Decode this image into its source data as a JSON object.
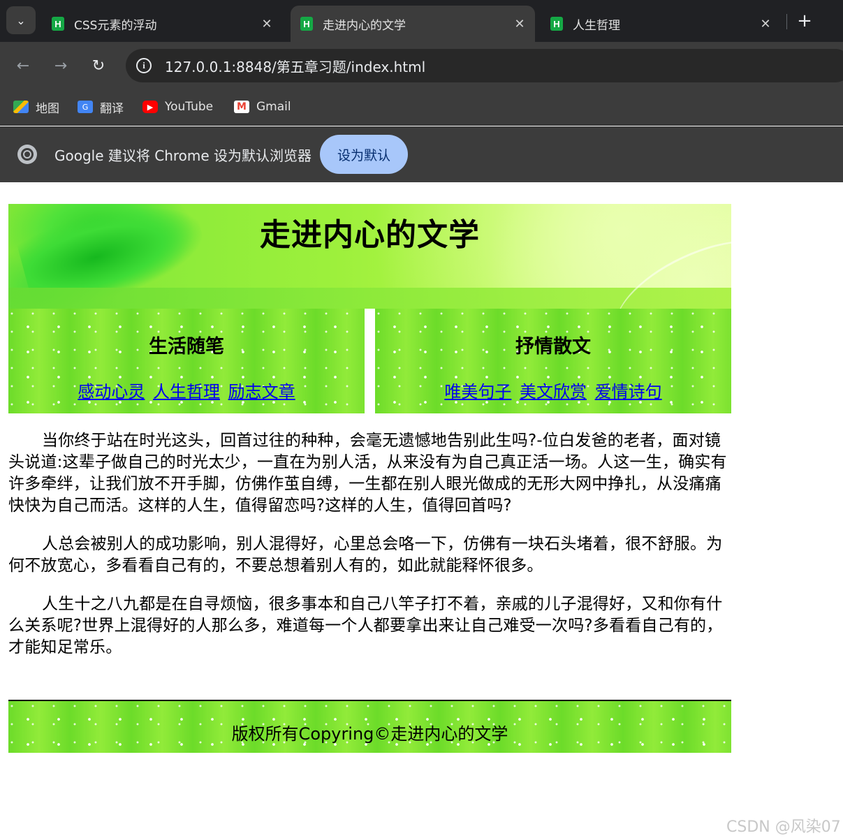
{
  "browser": {
    "tabs": [
      {
        "title": "CSS元素的浮动",
        "favicon": "H",
        "active": false
      },
      {
        "title": "走进内心的文学",
        "favicon": "H",
        "active": true
      },
      {
        "title": "人生哲理",
        "favicon": "H",
        "active": false
      }
    ],
    "url": "127.0.0.1:8848/第五章习题/index.html",
    "bookmarks": [
      {
        "label": "地图",
        "icon": "maps-icon"
      },
      {
        "label": "翻译",
        "icon": "translate-icon"
      },
      {
        "label": "YouTube",
        "icon": "youtube-icon"
      },
      {
        "label": "Gmail",
        "icon": "gmail-icon"
      }
    ],
    "infobar": {
      "message": "Google 建议将 Chrome 设为默认浏览器",
      "button": "设为默认"
    }
  },
  "page": {
    "title": "走进内心的文学",
    "sections": [
      {
        "heading": "生活随笔",
        "links": [
          "感动心灵",
          "人生哲理",
          "励志文章"
        ]
      },
      {
        "heading": "抒情散文",
        "links": [
          "唯美句子",
          "美文欣赏",
          "爱情诗句"
        ]
      }
    ],
    "paragraphs": [
      "当你终于站在时光这头，回首过往的种种，会毫无遗憾地告别此生吗?-位白发爸的老者，面对镜头说道:这辈子做自己的时光太少，一直在为别人活，从来没有为自己真正活一场。人这一生，确实有许多牵绊，让我们放不开手脚，仿佛作茧自缚，一生都在别人眼光做成的无形大网中挣扎，从没痛痛快快为自己而活。这样的人生，值得留恋吗?这样的人生，值得回首吗?",
      "人总会被别人的成功影响，别人混得好，心里总会咯一下，仿佛有一块石头堵着，很不舒服。为何不放宽心，多看看自己有的，不要总想着别人有的，如此就能释怀很多。",
      "人生十之八九都是在自寻烦恼，很多事本和自己八竿子打不着，亲戚的儿子混得好，又和你有什么关系呢?世界上混得好的人那么多，难道每一个人都要拿出来让自己难受一次吗?多看看自己有的，才能知足常乐。"
    ],
    "footer": "版权所有Copyring©走进内心的文学"
  },
  "watermark": "CSDN @风染07"
}
